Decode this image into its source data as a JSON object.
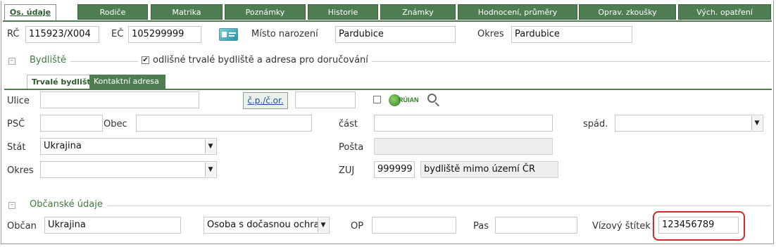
{
  "tabs": [
    "Os. údaje",
    "Rodiče",
    "Matrika",
    "Poznámky",
    "Historie",
    "Známky",
    "Hodnocení, průměry",
    "Oprav. zkoušky",
    "Vých. opatření"
  ],
  "top": {
    "rc_label": "RČ",
    "rc_value": "115923/X004",
    "ec_label": "EČ",
    "ec_value": "105299999",
    "birthplace_label": "Místo narození",
    "birthplace_value": "Pardubice",
    "district_label": "Okres",
    "district_value": "Pardubice"
  },
  "bydliste": {
    "title": "Bydliště",
    "different_label": "odlišné trvalé bydliště a adresa pro doručování",
    "different_checked": "✔",
    "subtabs": [
      "Trvalé bydliště",
      "Kontaktní adresa"
    ]
  },
  "address": {
    "street_label": "Ulice",
    "street_value": "",
    "cp_button": "č.p./č.or.",
    "cp_value": "",
    "ruian_label": "RÚIAN",
    "psc_label": "PSČ",
    "psc_value": "",
    "obec_label": "Obec",
    "obec_value": "",
    "cast_label": "část",
    "cast_value": "",
    "spad_label": "spád.",
    "spad_value": "",
    "stat_label": "Stát",
    "stat_value": "Ukrajina",
    "posta_label": "Pošta",
    "posta_value": "",
    "okres_label": "Okres",
    "okres_value": "",
    "zuj_label": "ZUJ",
    "zuj_code": "999999",
    "zuj_text": "bydliště mimo území ČR"
  },
  "civic": {
    "title": "Občanské údaje",
    "citizen_label": "Občan",
    "citizen_value": "Ukrajina",
    "status_value": "Osoba s dočasnou ochra",
    "op_label": "OP",
    "op_value": "",
    "pas_label": "Pas",
    "pas_value": "",
    "visa_label": "Vízový štítek",
    "visa_value": "123456789"
  },
  "colors": {
    "tab_green": "#4f7d52",
    "section_green": "#3d7a3f",
    "highlight_red": "#d9262b"
  }
}
